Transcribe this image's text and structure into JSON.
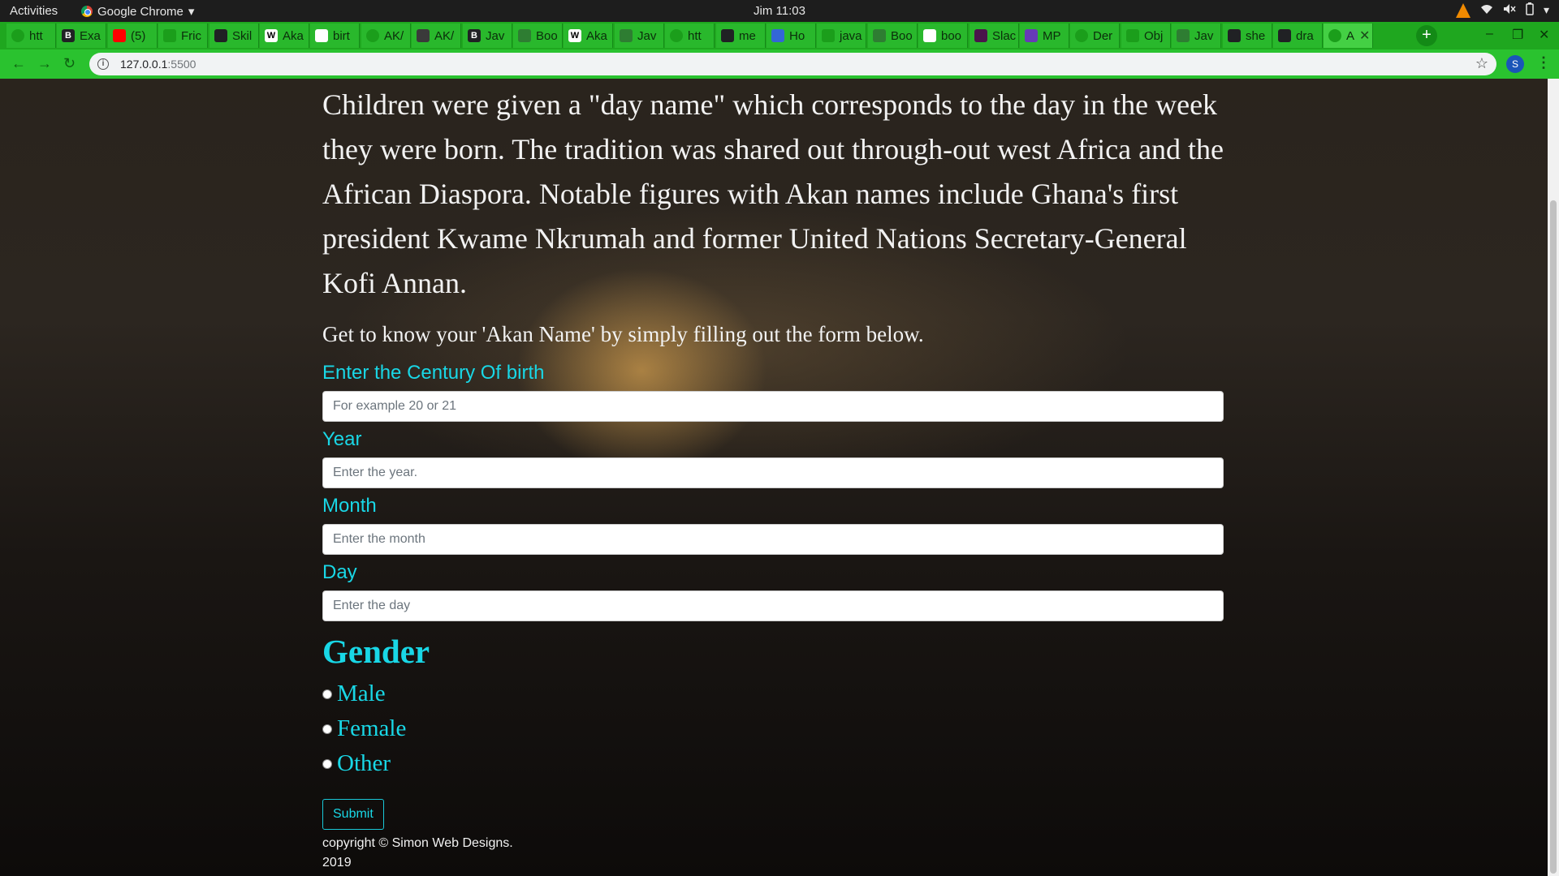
{
  "os_bar": {
    "activities": "Activities",
    "app_name": "Google Chrome",
    "app_menu_arrow": "▾",
    "clock": "Jim 11:03"
  },
  "tabs": [
    {
      "label": "htt",
      "favicon": "green-circle",
      "color": "#1b9e1b"
    },
    {
      "label": "Exa",
      "favicon": "B",
      "color": "#202124"
    },
    {
      "label": "(5)",
      "favicon": "youtube",
      "color": "#ff0000"
    },
    {
      "label": "Fric",
      "favicon": "leaf",
      "color": "#1b9e1b"
    },
    {
      "label": "Skil",
      "favicon": "github",
      "color": "#202124"
    },
    {
      "label": "Aka",
      "favicon": "W",
      "color": "#ffffff"
    },
    {
      "label": "birt",
      "favicon": "google",
      "color": "#ffffff"
    },
    {
      "label": "AK/",
      "favicon": "green-circle",
      "color": "#1b9e1b"
    },
    {
      "label": "AK/",
      "favicon": "book",
      "color": "#3a3a3a"
    },
    {
      "label": "Jav",
      "favicon": "B",
      "color": "#202124"
    },
    {
      "label": "Boo",
      "favicon": "grid",
      "color": "#2e7d32"
    },
    {
      "label": "Aka",
      "favicon": "W",
      "color": "#ffffff"
    },
    {
      "label": "Jav",
      "favicon": "grid",
      "color": "#2e7d32"
    },
    {
      "label": "htt",
      "favicon": "green-circle",
      "color": "#1b9e1b"
    },
    {
      "label": "me",
      "favicon": "github",
      "color": "#202124"
    },
    {
      "label": "Ho",
      "favicon": "windows",
      "color": "#3367d6"
    },
    {
      "label": "java",
      "favicon": "leaf",
      "color": "#1b9e1b"
    },
    {
      "label": "Boo",
      "favicon": "grid",
      "color": "#2e7d32"
    },
    {
      "label": "boo",
      "favicon": "google",
      "color": "#ffffff"
    },
    {
      "label": "Slac",
      "favicon": "slack",
      "color": "#4a154b"
    },
    {
      "label": "MP",
      "favicon": "list",
      "color": "#673ab7"
    },
    {
      "label": "Der",
      "favicon": "green-circle",
      "color": "#1b9e1b"
    },
    {
      "label": "Obj",
      "favicon": "leaf",
      "color": "#1b9e1b"
    },
    {
      "label": "Jav",
      "favicon": "grid",
      "color": "#2e7d32"
    },
    {
      "label": "she",
      "favicon": "github",
      "color": "#202124"
    },
    {
      "label": "dra",
      "favicon": "github",
      "color": "#202124"
    },
    {
      "label": "A",
      "favicon": "green-circle",
      "color": "#1b9e1b",
      "active": true
    }
  ],
  "tab_close": "✕",
  "new_tab": "+",
  "window_controls": {
    "minimize": "–",
    "maximize": "❐",
    "close": "✕"
  },
  "toolbar": {
    "back": "←",
    "forward": "→",
    "reload": "↻",
    "url_host": "127.0.0.1",
    "url_port": ":5500",
    "info": "i",
    "star": "☆",
    "profile_initial": "S",
    "menu": "⋮"
  },
  "content": {
    "intro": "Children were given a \"day name\" which corresponds to the day in the week they were born. The tradition was shared out through-out west Africa and the African Diaspora. Notable figures with Akan names include Ghana's first president Kwame Nkrumah and former United Nations Secretary-General Kofi Annan.",
    "cta": "Get to know your 'Akan Name' by simply filling out the form below."
  },
  "form": {
    "century": {
      "label": "Enter the Century Of birth",
      "placeholder": "For example 20 or 21",
      "value": ""
    },
    "year": {
      "label": "Year",
      "placeholder": "Enter the year.",
      "value": ""
    },
    "month": {
      "label": "Month",
      "placeholder": "Enter the month",
      "value": ""
    },
    "day": {
      "label": "Day",
      "placeholder": "Enter the day",
      "value": ""
    },
    "gender_title": "Gender",
    "gender_options": [
      "Male",
      "Female",
      "Other"
    ],
    "submit_label": "Submit"
  },
  "footer": {
    "copyright": "copyright © Simon Web Designs. 2019"
  },
  "colors": {
    "accent": "#19d7e6",
    "tab_green": "#29b82c",
    "text_light": "#f2f2f2"
  }
}
